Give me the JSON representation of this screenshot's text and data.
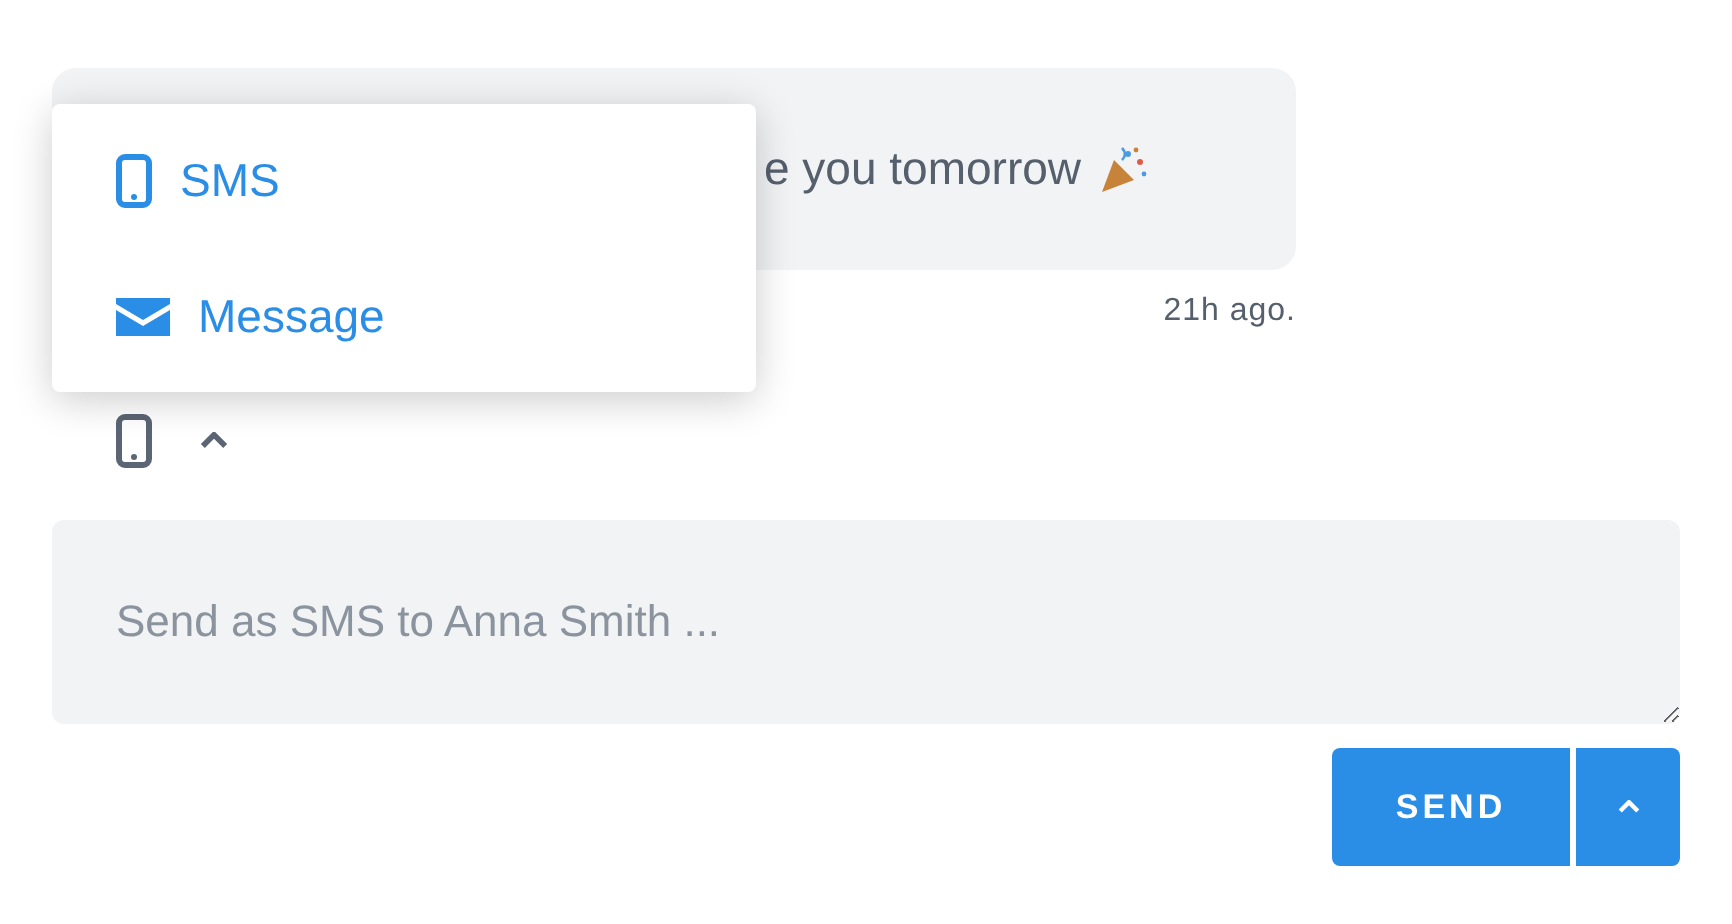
{
  "message": {
    "text": "e you tomorrow",
    "time": "21h ago."
  },
  "channel_menu": {
    "expanded": true,
    "items": [
      {
        "kind": "phone",
        "label": "SMS"
      },
      {
        "kind": "mail",
        "label": "Message"
      }
    ]
  },
  "channel_button": {
    "kind": "phone"
  },
  "composer": {
    "placeholder": "Send as SMS to Anna Smith ..."
  },
  "send_button": {
    "label": "SEND"
  }
}
